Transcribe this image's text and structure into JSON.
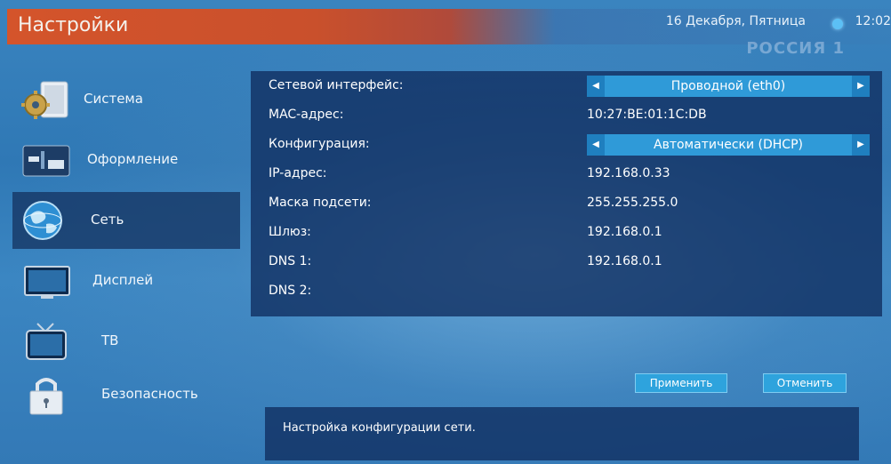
{
  "header": {
    "title": "Настройки",
    "datetime": "16 Декабря, Пятница",
    "clock": "12:02",
    "channel": "РОССИЯ 1"
  },
  "sidebar": {
    "items": [
      {
        "label": "Система",
        "icon": "gear-icon"
      },
      {
        "label": "Оформление",
        "icon": "appearance-icon"
      },
      {
        "label": "Сеть",
        "icon": "globe-icon",
        "active": true
      },
      {
        "label": "Дисплей",
        "icon": "monitor-icon"
      },
      {
        "label": "ТВ",
        "icon": "tv-icon"
      },
      {
        "label": "Безопасность",
        "icon": "lock-icon"
      }
    ]
  },
  "network": {
    "rows": [
      {
        "label": "Сетевой интерфейс:",
        "value": "Проводной (eth0)"
      },
      {
        "label": "MAC-адрес:",
        "value": "10:27:BE:01:1C:DB"
      },
      {
        "label": "Конфигурация:",
        "value": "Автоматически (DHCP)"
      },
      {
        "label": "IP-адрес:",
        "value": "192.168.0.33"
      },
      {
        "label": "Маска подсети:",
        "value": "255.255.255.0"
      },
      {
        "label": "Шлюз:",
        "value": "192.168.0.1"
      },
      {
        "label": "DNS 1:",
        "value": "192.168.0.1"
      },
      {
        "label": "DNS 2:",
        "value": ""
      }
    ]
  },
  "buttons": {
    "apply": "Применить",
    "cancel": "Отменить"
  },
  "hint": "Настройка конфигурации сети.",
  "colors": {
    "accent_orange": "#d4542b",
    "panel": "#0f2d5f",
    "selector": "#2f9ad8",
    "button": "#2ea3dd"
  }
}
